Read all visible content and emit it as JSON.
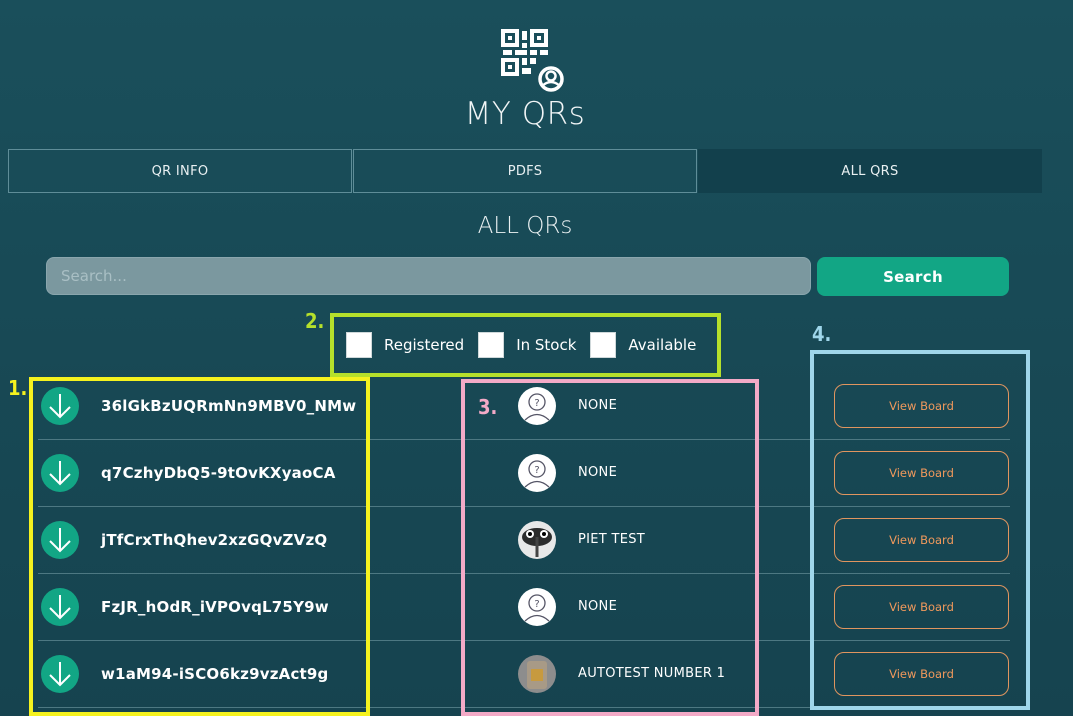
{
  "header": {
    "logo_icon": "qr-search-icon",
    "title": "MY QRs"
  },
  "tabs": [
    {
      "label": "QR INFO",
      "active": false
    },
    {
      "label": "PDFS",
      "active": false
    },
    {
      "label": "ALL QRS",
      "active": true
    }
  ],
  "section": {
    "title": "ALL QRs"
  },
  "search": {
    "placeholder": "Search...",
    "value": "",
    "button_label": "Search"
  },
  "filters": [
    {
      "label": "Registered",
      "checked": false
    },
    {
      "label": "In Stock",
      "checked": false
    },
    {
      "label": "Available",
      "checked": false
    }
  ],
  "annotations": [
    {
      "number": "1.",
      "color": "#f5f21f"
    },
    {
      "number": "2.",
      "color": "#b6e02b"
    },
    {
      "number": "3.",
      "color": "#f3aac7"
    },
    {
      "number": "4.",
      "color": "#9fd6ea"
    }
  ],
  "rows": [
    {
      "code": "36lGkBzUQRmNn9MBV0_NMw",
      "owner": "NONE",
      "avatar": "placeholder-person-icon",
      "action_label": "View Board"
    },
    {
      "code": "q7CzhyDbQ5-9tOvKXyaoCA",
      "owner": "NONE",
      "avatar": "placeholder-person-icon",
      "action_label": "View Board"
    },
    {
      "code": "jTfCrxThQhev2xzGQvZVzQ",
      "owner": "PIET TEST",
      "avatar": "bird-photo",
      "action_label": "View Board"
    },
    {
      "code": "FzJR_hOdR_iVPOvqL75Y9w",
      "owner": "NONE",
      "avatar": "placeholder-person-icon",
      "action_label": "View Board"
    },
    {
      "code": "w1aM94-iSCO6kz9vzAct9g",
      "owner": "AUTOTEST NUMBER 1",
      "avatar": "photo",
      "action_label": "View Board"
    }
  ],
  "colors": {
    "accent": "#12a685",
    "view_button": "#f0995c",
    "active_tab": "#12404c"
  }
}
